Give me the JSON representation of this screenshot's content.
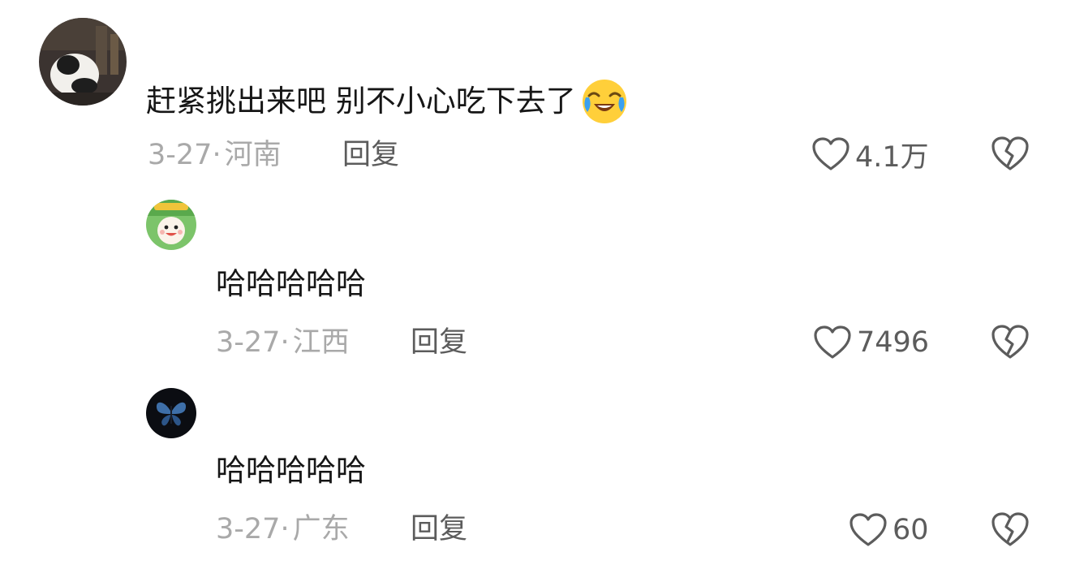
{
  "comments": [
    {
      "text": "赶紧挑出来吧 别不小心吃下去了",
      "emoji": "crying-laughing-emoji",
      "date": "3-27",
      "separator": "·",
      "location": "河南",
      "reply_label": "回复",
      "likes": "4.1万"
    },
    {
      "text": "哈哈哈哈哈",
      "date": "3-27",
      "separator": "·",
      "location": "江西",
      "reply_label": "回复",
      "likes": "7496"
    },
    {
      "text": "哈哈哈哈哈",
      "date": "3-27",
      "separator": "·",
      "location": "广东",
      "reply_label": "回复",
      "likes": "60"
    }
  ],
  "icons": {
    "like": "heart-outline-icon",
    "dislike": "broken-heart-icon"
  },
  "colors": {
    "background": "#ffffff",
    "text": "#161616",
    "meta": "#a9a9a9",
    "action": "#5c5c5c"
  }
}
